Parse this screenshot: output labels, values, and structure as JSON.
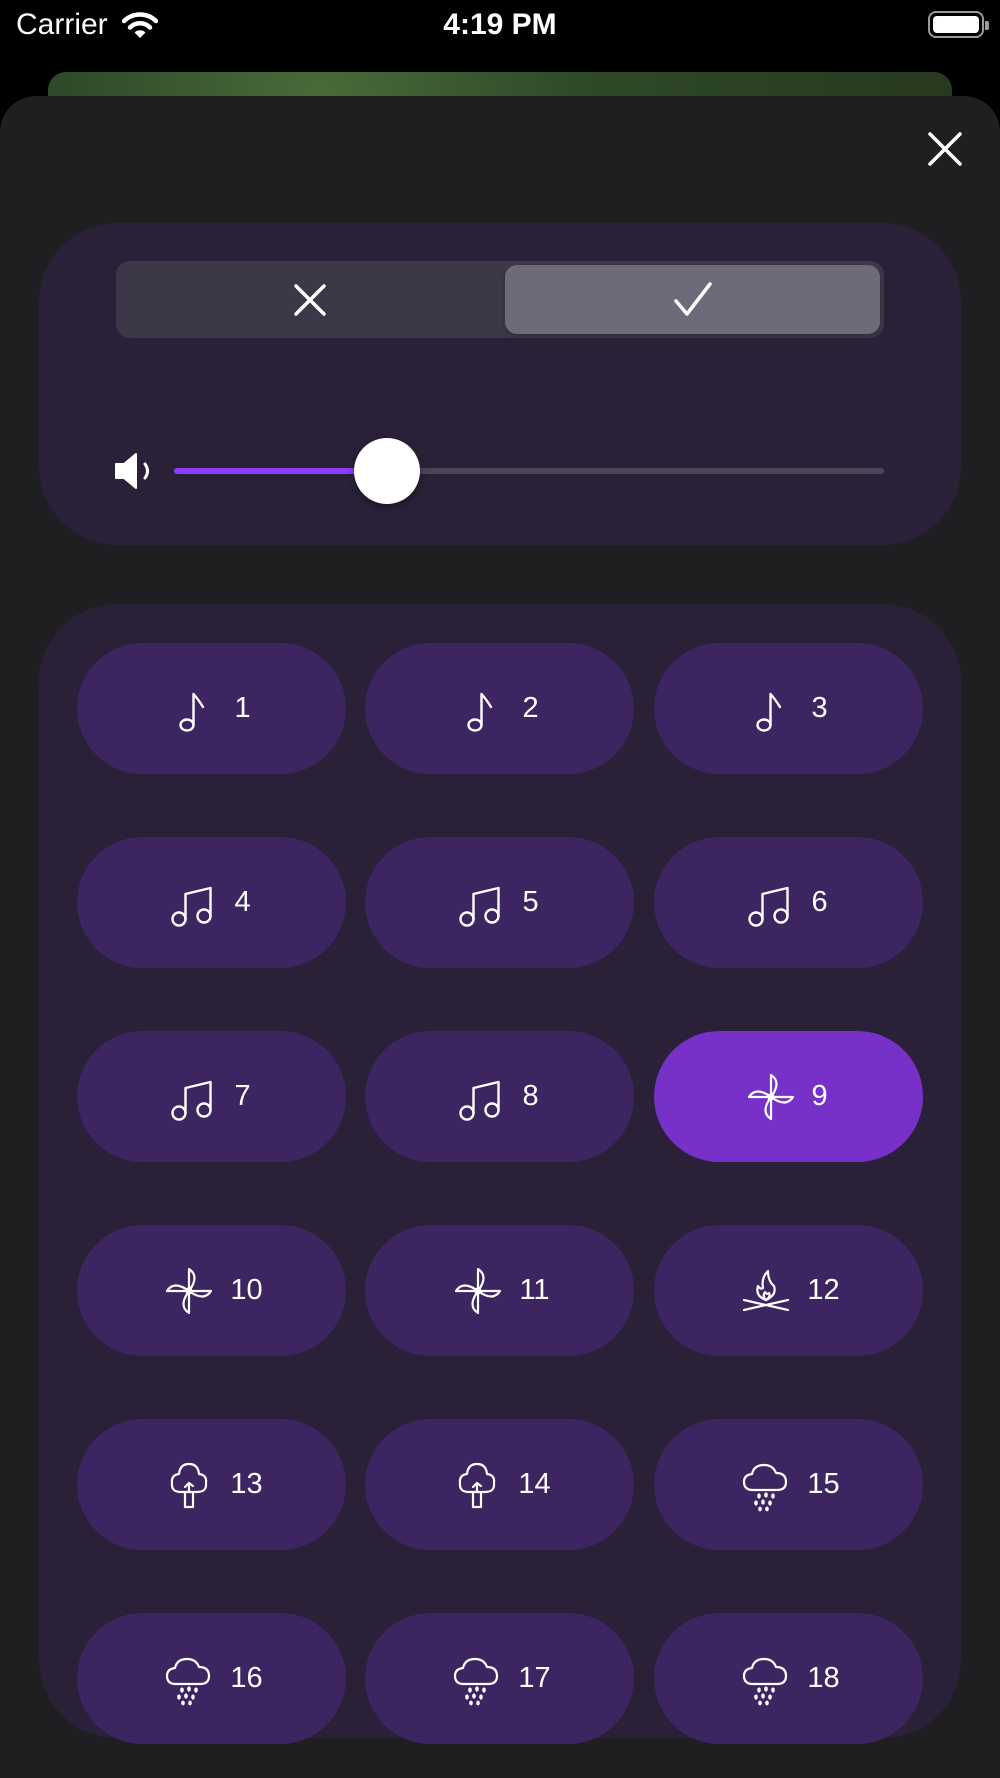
{
  "status_bar": {
    "carrier": "Carrier",
    "time": "4:19 PM",
    "icons": [
      "wifi-icon",
      "battery-icon"
    ]
  },
  "toggle": {
    "options": [
      {
        "icon": "close-icon",
        "selected": false
      },
      {
        "icon": "checkmark-icon",
        "selected": true
      }
    ]
  },
  "volume": {
    "icon": "speaker-icon",
    "level": 0.3
  },
  "colors": {
    "accent": "#8a3cff",
    "selected_button": "#7730c8",
    "button": "#3c2560",
    "card": "#2a2138",
    "sheet": "#1f1e21"
  },
  "sounds": [
    {
      "label": "1",
      "icon": "music-note-icon",
      "selected": false
    },
    {
      "label": "2",
      "icon": "music-note-icon",
      "selected": false
    },
    {
      "label": "3",
      "icon": "music-note-icon",
      "selected": false
    },
    {
      "label": "4",
      "icon": "music-notes-icon",
      "selected": false
    },
    {
      "label": "5",
      "icon": "music-notes-icon",
      "selected": false
    },
    {
      "label": "6",
      "icon": "music-notes-icon",
      "selected": false
    },
    {
      "label": "7",
      "icon": "music-notes-icon",
      "selected": false
    },
    {
      "label": "8",
      "icon": "music-notes-icon",
      "selected": false
    },
    {
      "label": "9",
      "icon": "pinwheel-icon",
      "selected": true
    },
    {
      "label": "10",
      "icon": "pinwheel-icon",
      "selected": false
    },
    {
      "label": "11",
      "icon": "pinwheel-icon",
      "selected": false
    },
    {
      "label": "12",
      "icon": "campfire-icon",
      "selected": false
    },
    {
      "label": "13",
      "icon": "tree-icon",
      "selected": false
    },
    {
      "label": "14",
      "icon": "tree-icon",
      "selected": false
    },
    {
      "label": "15",
      "icon": "rain-cloud-icon",
      "selected": false
    },
    {
      "label": "16",
      "icon": "rain-cloud-icon",
      "selected": false
    },
    {
      "label": "17",
      "icon": "rain-cloud-icon",
      "selected": false
    },
    {
      "label": "18",
      "icon": "rain-cloud-icon",
      "selected": false
    }
  ]
}
